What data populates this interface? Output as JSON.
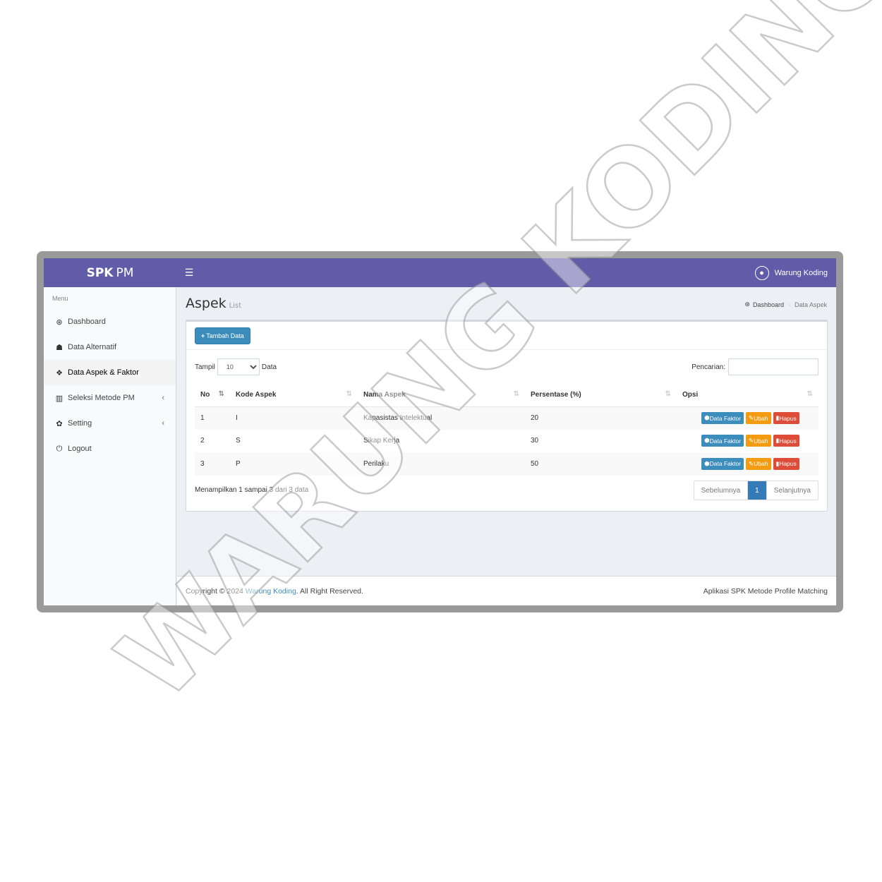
{
  "brand": {
    "bold": "SPK",
    "rest": "PM"
  },
  "topbar": {
    "toggle_icon": "bars-icon",
    "user_icon": "user-circle-icon",
    "user_name": "Warung Koding"
  },
  "sidebar": {
    "header": "Menu",
    "items": [
      {
        "label": "Dashboard",
        "icon": "tachometer-icon",
        "glyph": "⊛"
      },
      {
        "label": "Data Alternatif",
        "icon": "users-icon",
        "glyph": "☗"
      },
      {
        "label": "Data Aspek & Faktor",
        "icon": "cubes-icon",
        "glyph": "❖",
        "active": true
      },
      {
        "label": "Seleksi Metode PM",
        "icon": "bar-chart-icon",
        "glyph": "▥",
        "chevron": "‹"
      },
      {
        "label": "Setting",
        "icon": "gear-icon",
        "glyph": "✿",
        "chevron": "‹"
      },
      {
        "label": "Logout",
        "icon": "power-icon",
        "glyph": "⏻"
      }
    ]
  },
  "page": {
    "title": "Aspek",
    "subtitle": "List"
  },
  "breadcrumb": {
    "home_icon": "dashboard-icon",
    "home": "Dashboard",
    "separator": "›",
    "current": "Data Aspek"
  },
  "box": {
    "add_button": "Tambah Data"
  },
  "table_controls": {
    "show_label": "Tampil",
    "show_value": "10",
    "show_suffix": "Data",
    "search_label": "Pencarian:"
  },
  "table": {
    "headers": [
      "No",
      "Kode Aspek",
      "Nama Aspek",
      "Persentase (%)",
      "Opsi"
    ],
    "rows": [
      {
        "no": "1",
        "kode": "I",
        "nama": "Kapasistas Intelektual",
        "persen": "20"
      },
      {
        "no": "2",
        "kode": "S",
        "nama": "Sikap Kerja",
        "persen": "30"
      },
      {
        "no": "3",
        "kode": "P",
        "nama": "Perilaku",
        "persen": "50"
      }
    ],
    "actions": {
      "faktor": "Data Faktor",
      "ubah": "Ubah",
      "hapus": "Hapus"
    }
  },
  "pagination": {
    "info": "Menampilkan 1 sampai 3 dari 3 data",
    "prev": "Sebelumnya",
    "current": "1",
    "next": "Selanjutnya"
  },
  "footer": {
    "prefix": "Copyright © 2024 ",
    "link": "Warung Koding",
    "suffix": ". All Right Reserved.",
    "right": "Aplikasi SPK Metode Profile Matching"
  },
  "watermark": {
    "text": "WARUNG KODING"
  },
  "colors": {
    "header": "#605ca8",
    "primary": "#3c8dbc",
    "warning": "#f39c12",
    "danger": "#dd4b39"
  }
}
